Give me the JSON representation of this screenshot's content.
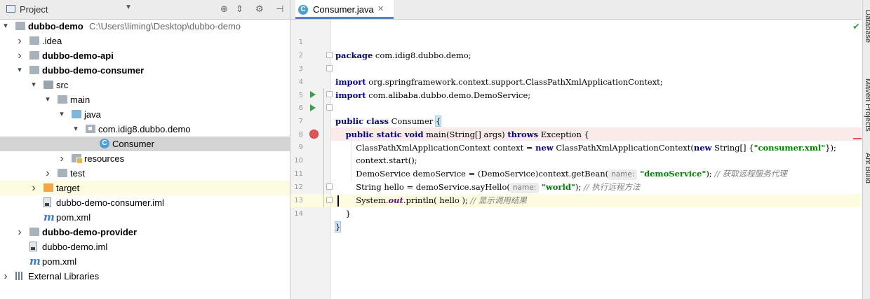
{
  "project_panel": {
    "title": "Project",
    "tree": [
      {
        "label": "dubbo-demo",
        "path": "C:\\Users\\liming\\Desktop\\dubbo-demo",
        "icon": "module-folder-icon",
        "bold": true,
        "arrow": "▾",
        "depth": 0
      },
      {
        "label": ".idea",
        "icon": "folder-icon",
        "arrow": "›",
        "depth": 1
      },
      {
        "label": "dubbo-demo-api",
        "icon": "module-folder-icon",
        "bold": true,
        "arrow": "›",
        "depth": 1
      },
      {
        "label": "dubbo-demo-consumer",
        "icon": "module-folder-icon",
        "bold": true,
        "arrow": "▾",
        "depth": 1
      },
      {
        "label": "src",
        "icon": "source-folder-icon",
        "arrow": "▾",
        "depth": 2
      },
      {
        "label": "main",
        "icon": "folder-icon",
        "arrow": "▾",
        "depth": 3
      },
      {
        "label": "java",
        "icon": "java-source-folder-icon",
        "arrow": "▾",
        "depth": 4
      },
      {
        "label": "com.idig8.dubbo.demo",
        "icon": "package-icon",
        "arrow": "▾",
        "depth": 5
      },
      {
        "label": "Consumer",
        "icon": "java-class-icon",
        "arrow": "",
        "depth": 6,
        "selected": true
      },
      {
        "label": "resources",
        "icon": "resources-folder-icon",
        "arrow": "›",
        "depth": 4
      },
      {
        "label": "test",
        "icon": "folder-icon",
        "arrow": "›",
        "depth": 3
      },
      {
        "label": "target",
        "icon": "excluded-folder-icon",
        "arrow": "›",
        "depth": 2,
        "highlight": true
      },
      {
        "label": "dubbo-demo-consumer.iml",
        "icon": "iml-file-icon",
        "arrow": "",
        "depth": 2
      },
      {
        "label": "pom.xml",
        "icon": "maven-file-icon",
        "arrow": "",
        "depth": 2
      },
      {
        "label": "dubbo-demo-provider",
        "icon": "module-folder-icon",
        "bold": true,
        "arrow": "›",
        "depth": 1
      },
      {
        "label": "dubbo-demo.iml",
        "icon": "iml-file-icon",
        "arrow": "",
        "depth": 1
      },
      {
        "label": "pom.xml",
        "icon": "maven-file-icon",
        "arrow": "",
        "depth": 1
      },
      {
        "label": "External Libraries",
        "icon": "libraries-icon",
        "arrow": "›",
        "depth": 0
      }
    ]
  },
  "editor": {
    "tab": {
      "label": "Consumer.java",
      "close": "✕"
    },
    "line_numbers": [
      "1",
      "2",
      "3",
      "4",
      "5",
      "6",
      "7",
      "8",
      "9",
      "10",
      "11",
      "12",
      "13",
      "14"
    ],
    "code": {
      "l1_kw": "package",
      "l1_rest": " com.idig8.dubbo.demo;",
      "l3_kw": "import",
      "l3_rest": " org.springframework.context.support.ClassPathXmlApplicationContext;",
      "l4_kw": "import",
      "l4_rest": " com.alibaba.dubbo.demo.DemoService;",
      "l6_kw": "public class",
      "l6_rest": " Consumer ",
      "l6_brace": "{",
      "l7_indent": "    ",
      "l7_kw1": "public static void",
      "l7_mid": " main(String[] args) ",
      "l7_kw2": "throws",
      "l7_rest": " Exception {",
      "l8_a": "        ClassPathXmlApplicationContext context = ",
      "l8_kw1": "new",
      "l8_b": " ClassPathXmlApplicationContext(",
      "l8_kw2": "new",
      "l8_c": " String[] {",
      "l8_str": "\"consumer.xml\"",
      "l8_d": "});",
      "l9": "        context.start();",
      "l10_a": "        DemoService demoService = (DemoService)context.getBean(",
      "l10_hint": "name:",
      "l10_str": "\"demoService\"",
      "l10_b": "); ",
      "l10_cmt": "// 获取远程服务代理",
      "l11_a": "        String hello = demoService.sayHello(",
      "l11_hint": "name:",
      "l11_str": "\"world\"",
      "l11_b": "); ",
      "l11_cmt": "// 执行远程方法",
      "l12_a": "        System.",
      "l12_st": "out",
      "l12_b": ".println( hello ); ",
      "l12_cmt": "// 显示调用结果",
      "l13": "    }",
      "l14": "}"
    }
  },
  "right_tool_windows": [
    "Database",
    "Maven Projects",
    "Ant Build"
  ]
}
